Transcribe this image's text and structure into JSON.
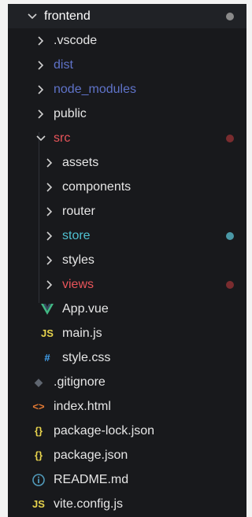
{
  "explorer": {
    "root": {
      "label": "frontend",
      "expanded": true,
      "icon": "chevron-down-icon",
      "dot_color": "#8a8a8a",
      "text_color": "#ffffff"
    },
    "items": [
      {
        "label": ".vscode",
        "kind": "folder",
        "expanded": false,
        "text_color": "#e6e6e6"
      },
      {
        "label": "dist",
        "kind": "folder",
        "expanded": false,
        "text_color": "#5f73c9"
      },
      {
        "label": "node_modules",
        "kind": "folder",
        "expanded": false,
        "text_color": "#5f73c9"
      },
      {
        "label": "public",
        "kind": "folder",
        "expanded": false,
        "text_color": "#e6e6e6"
      },
      {
        "label": "src",
        "kind": "folder",
        "expanded": true,
        "text_color": "#e8545a",
        "dot_color": "#7a2c2f"
      },
      {
        "label": "assets",
        "kind": "folder",
        "expanded": false,
        "text_color": "#e6e6e6"
      },
      {
        "label": "components",
        "kind": "folder",
        "expanded": false,
        "text_color": "#e6e6e6"
      },
      {
        "label": "router",
        "kind": "folder",
        "expanded": false,
        "text_color": "#e6e6e6"
      },
      {
        "label": "store",
        "kind": "folder",
        "expanded": false,
        "text_color": "#4fc1d1",
        "dot_color": "#4a98a6"
      },
      {
        "label": "styles",
        "kind": "folder",
        "expanded": false,
        "text_color": "#e6e6e6"
      },
      {
        "label": "views",
        "kind": "folder",
        "expanded": false,
        "text_color": "#e8545a",
        "dot_color": "#7a2c2f"
      },
      {
        "label": "App.vue",
        "kind": "file",
        "icon": "vue-icon",
        "icon_text": "V",
        "icon_color": "#41b883",
        "text_color": "#e6e6e6"
      },
      {
        "label": "main.js",
        "kind": "file",
        "icon": "javascript-icon",
        "icon_text": "JS",
        "icon_color": "#e8d44d",
        "text_color": "#e6e6e6"
      },
      {
        "label": "style.css",
        "kind": "file",
        "icon": "css-hash-icon",
        "icon_text": "#",
        "icon_color": "#42a5f5",
        "text_color": "#e6e6e6"
      },
      {
        "label": ".gitignore",
        "kind": "file",
        "icon": "git-diamond-icon",
        "icon_text": "◆",
        "icon_color": "#5f6670",
        "text_color": "#e6e6e6"
      },
      {
        "label": "index.html",
        "kind": "file",
        "icon": "html-tag-icon",
        "icon_text": "<>",
        "icon_color": "#e37933",
        "text_color": "#e6e6e6"
      },
      {
        "label": "package-lock.json",
        "kind": "file",
        "icon": "json-braces-icon",
        "icon_text": "{}",
        "icon_color": "#e8d44d",
        "text_color": "#e6e6e6"
      },
      {
        "label": "package.json",
        "kind": "file",
        "icon": "json-braces-icon",
        "icon_text": "{}",
        "icon_color": "#e8d44d",
        "text_color": "#e6e6e6"
      },
      {
        "label": "README.md",
        "kind": "file",
        "icon": "info-icon",
        "icon_text": "i",
        "icon_color": "#519aba",
        "text_color": "#e6e6e6"
      },
      {
        "label": "vite.config.js",
        "kind": "file",
        "icon": "javascript-icon",
        "icon_text": "JS",
        "icon_color": "#e8d44d",
        "text_color": "#e6e6e6"
      }
    ]
  }
}
